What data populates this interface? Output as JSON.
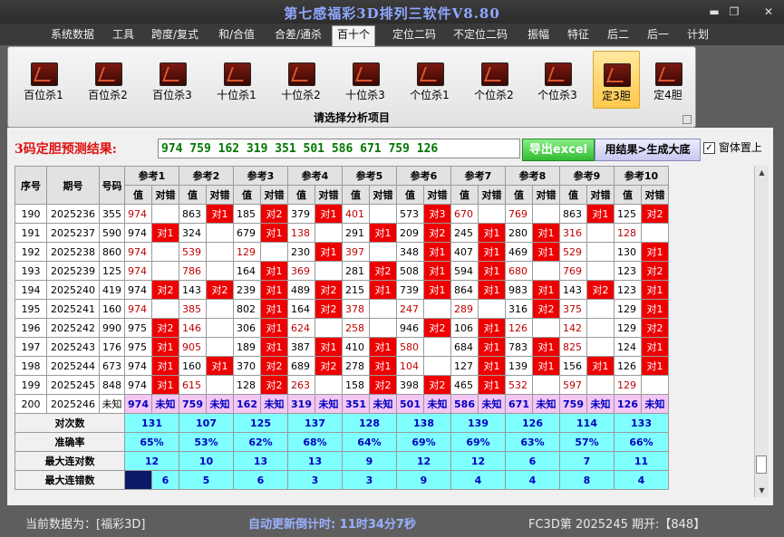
{
  "window": {
    "title": "第七感福彩3D排列三软件V8.80",
    "minimize": "▬",
    "maximize": "❐",
    "close": "✕"
  },
  "menu": [
    "系统数据",
    "工具",
    "跨度/复式",
    "和/合值",
    "合差/通杀",
    "百十个",
    "定位二码",
    "不定位二码",
    "振幅",
    "特征",
    "后二",
    "后一",
    "计划"
  ],
  "ribbon": {
    "buttons": [
      "百位杀1",
      "百位杀2",
      "百位杀3",
      "十位杀1",
      "十位杀2",
      "十位杀3",
      "个位杀1",
      "个位杀2",
      "个位杀3",
      "定3胆",
      "定4胆"
    ],
    "caption": "请选择分析项目"
  },
  "prediction": {
    "label": "3码定胆预测结果:",
    "value": "974  759  162  319  351  501  586  671  759  126",
    "export_label": "导出excel",
    "generate_label": "用结果>生成大底",
    "topmost_label": "窗体置上",
    "topmost_checked": "✓"
  },
  "table": {
    "headers": {
      "seq": "序号",
      "period": "期号",
      "number": "号码",
      "val": "值",
      "result": "对错"
    },
    "refs": [
      "参考1",
      "参考2",
      "参考3",
      "参考4",
      "参考5",
      "参考6",
      "参考7",
      "参考8",
      "参考9",
      "参考10"
    ],
    "rows": [
      {
        "seq": "190",
        "period": "2025236",
        "num": "355",
        "cells": [
          [
            "974",
            "",
            1
          ],
          [
            "863",
            "对1",
            0
          ],
          [
            "185",
            "对2",
            0
          ],
          [
            "379",
            "对1",
            0
          ],
          [
            "401",
            "",
            1
          ],
          [
            "573",
            "对3",
            0
          ],
          [
            "670",
            "",
            1
          ],
          [
            "769",
            "",
            1
          ],
          [
            "863",
            "对1",
            0
          ],
          [
            "125",
            "对2",
            0
          ]
        ]
      },
      {
        "seq": "191",
        "period": "2025237",
        "num": "590",
        "cells": [
          [
            "974",
            "对1",
            0
          ],
          [
            "324",
            "",
            0
          ],
          [
            "679",
            "对1",
            0
          ],
          [
            "138",
            "",
            1
          ],
          [
            "291",
            "对1",
            0
          ],
          [
            "209",
            "对2",
            0
          ],
          [
            "245",
            "对1",
            0
          ],
          [
            "280",
            "对1",
            0
          ],
          [
            "316",
            "",
            1
          ],
          [
            "128",
            "",
            1
          ]
        ]
      },
      {
        "seq": "192",
        "period": "2025238",
        "num": "860",
        "cells": [
          [
            "974",
            "",
            1
          ],
          [
            "539",
            "",
            1
          ],
          [
            "129",
            "",
            1
          ],
          [
            "230",
            "对1",
            0
          ],
          [
            "397",
            "",
            1
          ],
          [
            "348",
            "对1",
            0
          ],
          [
            "407",
            "对1",
            0
          ],
          [
            "469",
            "对1",
            0
          ],
          [
            "529",
            "",
            1
          ],
          [
            "130",
            "对1",
            0
          ]
        ]
      },
      {
        "seq": "193",
        "period": "2025239",
        "num": "125",
        "cells": [
          [
            "974",
            "",
            1
          ],
          [
            "786",
            "",
            1
          ],
          [
            "164",
            "对1",
            0
          ],
          [
            "369",
            "",
            1
          ],
          [
            "281",
            "对2",
            0
          ],
          [
            "508",
            "对1",
            0
          ],
          [
            "594",
            "对1",
            0
          ],
          [
            "680",
            "",
            1
          ],
          [
            "769",
            "",
            1
          ],
          [
            "123",
            "对2",
            0
          ]
        ]
      },
      {
        "seq": "194",
        "period": "2025240",
        "num": "419",
        "cells": [
          [
            "974",
            "对2",
            0
          ],
          [
            "143",
            "对2",
            0
          ],
          [
            "239",
            "对1",
            0
          ],
          [
            "489",
            "对2",
            0
          ],
          [
            "215",
            "对1",
            0
          ],
          [
            "739",
            "对1",
            0
          ],
          [
            "864",
            "对1",
            0
          ],
          [
            "983",
            "对1",
            0
          ],
          [
            "143",
            "对2",
            0
          ],
          [
            "123",
            "对1",
            0
          ]
        ]
      },
      {
        "seq": "195",
        "period": "2025241",
        "num": "160",
        "cells": [
          [
            "974",
            "",
            1
          ],
          [
            "385",
            "",
            1
          ],
          [
            "802",
            "对1",
            0
          ],
          [
            "164",
            "对2",
            0
          ],
          [
            "378",
            "",
            1
          ],
          [
            "247",
            "",
            1
          ],
          [
            "289",
            "",
            1
          ],
          [
            "316",
            "对2",
            0
          ],
          [
            "375",
            "",
            1
          ],
          [
            "129",
            "对1",
            0
          ]
        ]
      },
      {
        "seq": "196",
        "period": "2025242",
        "num": "990",
        "cells": [
          [
            "975",
            "对2",
            0
          ],
          [
            "146",
            "",
            1
          ],
          [
            "306",
            "对1",
            0
          ],
          [
            "624",
            "",
            1
          ],
          [
            "258",
            "",
            1
          ],
          [
            "946",
            "对2",
            0
          ],
          [
            "106",
            "对1",
            0
          ],
          [
            "126",
            "",
            1
          ],
          [
            "142",
            "",
            1
          ],
          [
            "129",
            "对2",
            0
          ]
        ]
      },
      {
        "seq": "197",
        "period": "2025243",
        "num": "176",
        "cells": [
          [
            "975",
            "对1",
            0
          ],
          [
            "905",
            "",
            1
          ],
          [
            "189",
            "对1",
            0
          ],
          [
            "387",
            "对1",
            0
          ],
          [
            "410",
            "对1",
            0
          ],
          [
            "580",
            "",
            1
          ],
          [
            "684",
            "对1",
            0
          ],
          [
            "783",
            "对1",
            0
          ],
          [
            "825",
            "",
            1
          ],
          [
            "124",
            "对1",
            0
          ]
        ]
      },
      {
        "seq": "198",
        "period": "2025244",
        "num": "673",
        "cells": [
          [
            "974",
            "对1",
            0
          ],
          [
            "160",
            "对1",
            0
          ],
          [
            "370",
            "对2",
            0
          ],
          [
            "689",
            "对2",
            0
          ],
          [
            "278",
            "对1",
            0
          ],
          [
            "104",
            "",
            1
          ],
          [
            "127",
            "对1",
            0
          ],
          [
            "139",
            "对1",
            0
          ],
          [
            "156",
            "对1",
            0
          ],
          [
            "126",
            "对1",
            0
          ]
        ]
      },
      {
        "seq": "199",
        "period": "2025245",
        "num": "848",
        "cells": [
          [
            "974",
            "对1",
            0
          ],
          [
            "615",
            "",
            1
          ],
          [
            "128",
            "对2",
            0
          ],
          [
            "263",
            "",
            1
          ],
          [
            "158",
            "对2",
            0
          ],
          [
            "398",
            "对2",
            0
          ],
          [
            "465",
            "对1",
            0
          ],
          [
            "532",
            "",
            1
          ],
          [
            "597",
            "",
            1
          ],
          [
            "129",
            "",
            1
          ]
        ]
      }
    ],
    "pred_row": {
      "seq": "200",
      "period": "2025246",
      "num": "未知",
      "values": [
        "974",
        "759",
        "162",
        "319",
        "351",
        "501",
        "586",
        "671",
        "759",
        "126"
      ],
      "unknown": "未知"
    },
    "stats": [
      {
        "label": "对次数",
        "values": [
          "131",
          "107",
          "125",
          "137",
          "128",
          "138",
          "139",
          "126",
          "114",
          "133"
        ]
      },
      {
        "label": "准确率",
        "values": [
          "65%",
          "53%",
          "62%",
          "68%",
          "64%",
          "69%",
          "69%",
          "63%",
          "57%",
          "66%"
        ]
      },
      {
        "label": "最大连对数",
        "values": [
          "12",
          "10",
          "13",
          "13",
          "9",
          "12",
          "12",
          "6",
          "7",
          "11"
        ]
      },
      {
        "label": "最大连错数",
        "values": [
          "6",
          "5",
          "6",
          "3",
          "3",
          "9",
          "4",
          "4",
          "8",
          "4"
        ]
      }
    ]
  },
  "status": {
    "data_source": "当前数据为：[福彩3D]",
    "countdown": "自动更新倒计时:  11时34分7秒",
    "issue": "FC3D第 2025245 期开:【848】"
  },
  "colors": {
    "hit": "#ee0000",
    "pred_row": "#f4c6f4",
    "stats": "#80ffff",
    "ribbon_selected": "#ffc84a"
  }
}
